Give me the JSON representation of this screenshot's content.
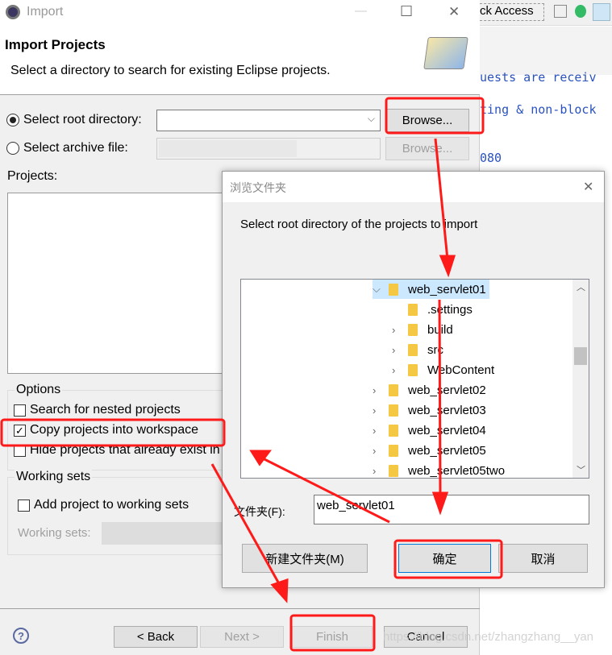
{
  "window": {
    "title": "Import",
    "minimize": "—",
    "maximize": "☐",
    "close": "✕"
  },
  "background": {
    "quick_access": "ck Access",
    "code_lines": [
      "uests are receiv",
      "ting & non-block",
      "080"
    ]
  },
  "header": {
    "title": "Import Projects",
    "subtitle": "Select a directory to search for existing Eclipse projects."
  },
  "source": {
    "root_label": "Select root directory:",
    "root_value": "",
    "root_selected": true,
    "archive_label": "Select archive file:",
    "archive_selected": false,
    "browse": "Browse...",
    "browse_archive": "Browse..."
  },
  "projects": {
    "label": "Projects:"
  },
  "options": {
    "title": "Options",
    "items": [
      {
        "label": "Search for nested projects",
        "checked": false
      },
      {
        "label": "Copy projects into workspace",
        "checked": true
      },
      {
        "label": "Hide projects that already exist in the workspace",
        "checked": false
      }
    ]
  },
  "working_sets": {
    "title": "Working sets",
    "add_label": "Add project to working sets",
    "add_checked": false,
    "sets_label": "Working sets:"
  },
  "footer": {
    "help": "?",
    "back": "< Back",
    "next": "Next >",
    "finish": "Finish",
    "cancel": "Cancel"
  },
  "folder_dialog": {
    "title": "浏览文件夹",
    "close": "✕",
    "prompt": "Select root directory of the projects to import",
    "tree": [
      {
        "label": "web_servlet01",
        "expanded": true,
        "selected": true,
        "level": 0
      },
      {
        "label": ".settings",
        "level": 1,
        "leaf": true
      },
      {
        "label": "build",
        "level": 1
      },
      {
        "label": "src",
        "level": 1
      },
      {
        "label": "WebContent",
        "level": 1
      },
      {
        "label": "web_servlet02",
        "level": 0
      },
      {
        "label": "web_servlet03",
        "level": 0
      },
      {
        "label": "web_servlet04",
        "level": 0
      },
      {
        "label": "web_servlet05",
        "level": 0
      },
      {
        "label": "web_servlet05two",
        "level": 0
      }
    ],
    "folder_label": "文件夹(F):",
    "folder_value": "web_servlet01",
    "new_folder": "新建文件夹(M)",
    "ok": "确定",
    "cancel": "取消"
  },
  "watermark": "https://blog.csdn.net/zhangzhang__yan",
  "colors": {
    "annotation": "#ff1a1a",
    "selection": "#cce8ff",
    "folder": "#f4c842"
  }
}
